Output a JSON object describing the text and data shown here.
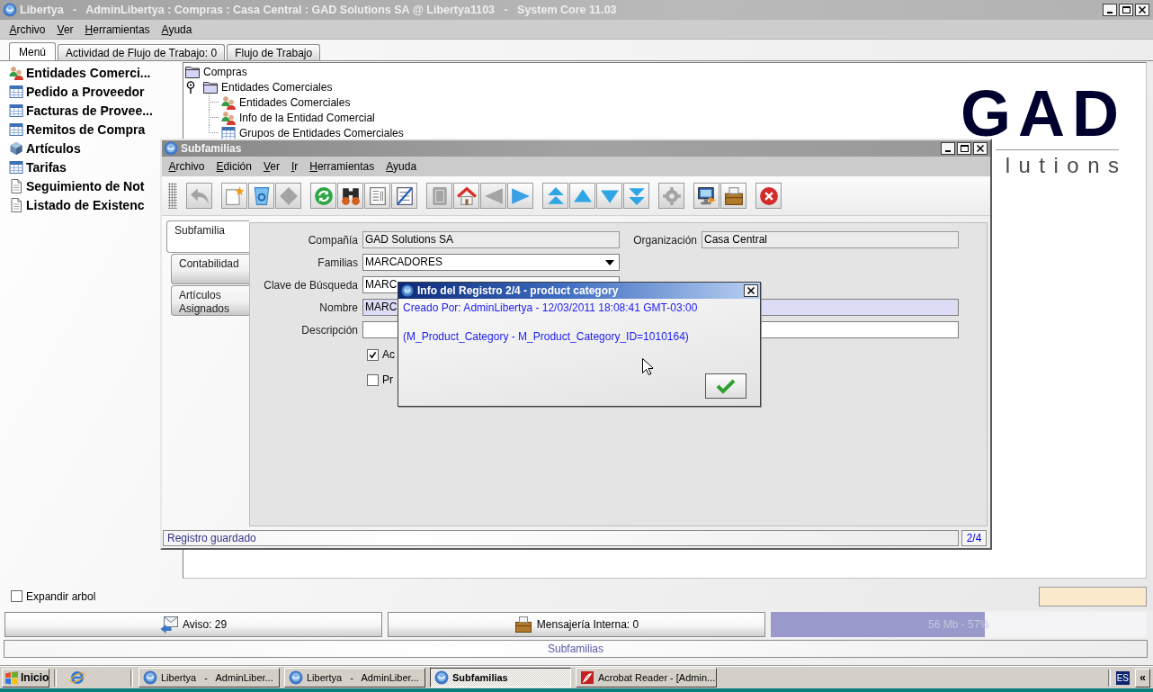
{
  "window": {
    "title": "Libertya   -   AdminLibertya : Compras : Casa Central : GAD Solutions SA @ Libertya1103   -   System Core 11.03"
  },
  "menu": [
    "Archivo",
    "Ver",
    "Herramientas",
    "Ayuda"
  ],
  "tabs": [
    {
      "label": "Menú",
      "selected": true
    },
    {
      "label": "Actividad de Flujo de Trabajo: 0",
      "selected": false
    },
    {
      "label": "Flujo de Trabajo",
      "selected": false
    }
  ],
  "sidebar": {
    "items": [
      {
        "label": "Entidades Comerci...",
        "kind": "people"
      },
      {
        "label": "Pedido a Proveedor",
        "kind": "table"
      },
      {
        "label": "Facturas de Provee...",
        "kind": "table"
      },
      {
        "label": "Remitos de Compra",
        "kind": "table"
      },
      {
        "label": "Artículos",
        "kind": "cube"
      },
      {
        "label": "Tarifas",
        "kind": "table"
      },
      {
        "label": "Seguimiento de Not",
        "kind": "document"
      },
      {
        "label": "Listado de Existenc",
        "kind": "document"
      }
    ]
  },
  "tree": [
    {
      "label": "Compras",
      "kind": "folder",
      "children": [
        {
          "label": "Entidades Comerciales",
          "kind": "folder",
          "expanded": true,
          "children": [
            {
              "label": "Entidades Comerciales",
              "kind": "people"
            },
            {
              "label": "Info de la Entidad Comercial",
              "kind": "people"
            },
            {
              "label": "Grupos de Entidades Comerciales",
              "kind": "table"
            }
          ]
        }
      ]
    }
  ],
  "logo": {
    "wordmark": "GAD",
    "tagline": "lutions"
  },
  "expand_tree": {
    "label": "Expandir arbol",
    "checked": false
  },
  "notices": [
    {
      "kind": "notice",
      "label": "Aviso: 29"
    },
    {
      "kind": "messages",
      "label": "Mensajería Interna: 0"
    }
  ],
  "memory": {
    "label": "56 Mb - 57%",
    "level": 0.57
  },
  "status_bar": {
    "text": "Subfamilias"
  },
  "subwindow": {
    "title": "Subfamilias",
    "menu": [
      "Archivo",
      "Edición",
      "Ver",
      "Ir",
      "Herramientas",
      "Ayuda"
    ],
    "toolbar": [
      {
        "buttons": [
          {
            "kind": "undo",
            "disabled": true
          }
        ]
      },
      {
        "buttons": [
          {
            "kind": "new",
            "disabled": false
          },
          {
            "kind": "delete",
            "disabled": false
          },
          {
            "kind": "save",
            "disabled": true
          }
        ]
      },
      {
        "buttons": [
          {
            "kind": "refresh",
            "disabled": false
          },
          {
            "kind": "find",
            "disabled": false
          },
          {
            "kind": "history",
            "disabled": false
          },
          {
            "kind": "grid",
            "disabled": false
          }
        ]
      },
      {
        "buttons": [
          {
            "kind": "attachment",
            "disabled": true
          },
          {
            "kind": "home",
            "disabled": false
          },
          {
            "kind": "left",
            "disabled": true
          },
          {
            "kind": "right",
            "disabled": false
          }
        ]
      },
      {
        "buttons": [
          {
            "kind": "first",
            "disabled": false
          },
          {
            "kind": "up",
            "disabled": false
          },
          {
            "kind": "down",
            "disabled": false
          },
          {
            "kind": "last",
            "disabled": false
          }
        ]
      },
      {
        "buttons": [
          {
            "kind": "process",
            "disabled": true
          }
        ]
      },
      {
        "buttons": [
          {
            "kind": "print",
            "disabled": false
          },
          {
            "kind": "archive",
            "disabled": false
          }
        ]
      },
      {
        "buttons": [
          {
            "kind": "close",
            "disabled": false
          }
        ]
      }
    ],
    "tabs": [
      {
        "label": "Subfamilia",
        "selected": true
      },
      {
        "label": "Contabilidad",
        "selected": false
      },
      {
        "label": "Artículos Asignados",
        "selected": false
      }
    ],
    "rows": [
      {
        "fields": [
          {
            "label": "Compañía",
            "value": "GAD Solutions SA",
            "kind": "readonly"
          },
          {
            "label": "Organización",
            "value": "Casa Central",
            "kind": "readonly"
          }
        ]
      },
      {
        "fields": [
          {
            "label": "Familias",
            "value": "MARCADORES",
            "kind": "dropdown"
          }
        ]
      },
      {
        "fields": [
          {
            "label": "Clave de Búsqueda",
            "value": "MARC",
            "kind": "text"
          }
        ]
      },
      {
        "fields": [
          {
            "label": "Nombre",
            "value": "MARC",
            "kind": "mandatory"
          }
        ]
      },
      {
        "fields": [
          {
            "label": "Descripción",
            "kind": "text"
          }
        ]
      }
    ],
    "checkboxes": [
      {
        "label": "Ac",
        "checked": true
      },
      {
        "label": "Pr",
        "checked": false
      }
    ],
    "status": {
      "message": "Registro guardado",
      "record": "2/4"
    }
  },
  "dialog": {
    "title": "Info del Registro 2/4 - product category",
    "lines": [
      "Creado Por: AdminLibertya - 12/03/2011 18:08:41 GMT-03:00",
      "(M_Product_Category - M_Product_Category_ID=1010164)"
    ]
  },
  "taskbar": {
    "start": "Inicio",
    "tasks": [
      {
        "label": "Libertya   -   AdminLiber...",
        "kind": "app",
        "selected": false
      },
      {
        "label": "Libertya   -   AdminLiber...",
        "kind": "app",
        "selected": false
      },
      {
        "label": "Subfamilias",
        "kind": "app",
        "selected": true
      },
      {
        "label": "Acrobat Reader - [Admin...",
        "kind": "pdf",
        "selected": false
      }
    ],
    "language": "ES",
    "tray_toggle": "«"
  }
}
